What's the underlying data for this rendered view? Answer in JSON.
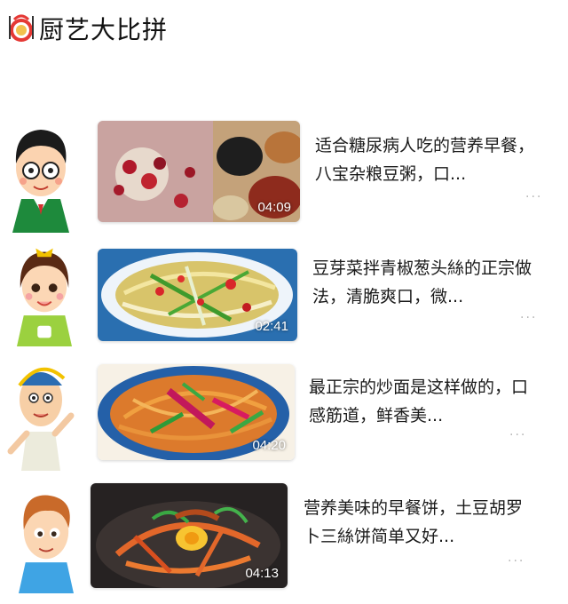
{
  "header": {
    "title": "厨艺大比拼",
    "logo_icon": "chef-plate-icon"
  },
  "more_glyph": "···",
  "items": [
    {
      "title": "适合糖尿病人吃的营养早餐，八宝杂粮豆粥，口...",
      "duration": "04:09"
    },
    {
      "title": "豆芽菜拌青椒葱头絲的正宗做法，清脆爽口，微...",
      "duration": "02:41"
    },
    {
      "title": "最正宗的炒面是这样做的，口感筋道，鲜香美...",
      "duration": "04:20"
    },
    {
      "title": "营养美味的早餐饼，土豆胡罗卜三絲饼简单又好...",
      "duration": "04:13"
    }
  ],
  "colors": {
    "accent_red": "#e53935",
    "text": "#1a1a1a",
    "muted": "#b5b5b5"
  }
}
